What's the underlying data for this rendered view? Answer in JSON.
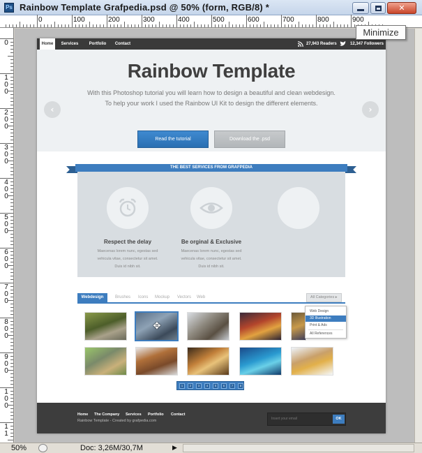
{
  "window": {
    "title": "Rainbow Template Grafpedia.psd @ 50% (form, RGB/8) *",
    "app_icon_label": "Ps",
    "minimize_tooltip": "Minimize",
    "close_glyph": "✕"
  },
  "rulers": {
    "top_labels": [
      "0",
      "100",
      "200",
      "300",
      "400",
      "500",
      "600",
      "700",
      "800",
      "900"
    ],
    "left_labels": [
      "0",
      "1\n0\n0",
      "2\n0\n0",
      "3\n0\n0",
      "4\n0\n0",
      "5\n0\n0",
      "6\n0\n0",
      "7\n0\n0",
      "8\n0\n0",
      "9\n0\n0",
      "1\n0\n0",
      "1\n1"
    ]
  },
  "page": {
    "nav": {
      "items": [
        "Home",
        "Services",
        "Portfolio",
        "Contact"
      ],
      "readers": "27,943 Readers",
      "followers": "12,347 Followers"
    },
    "hero": {
      "title": "Rainbow Template",
      "desc_line1": "With this Photoshop tutorial you will learn how to design a beautiful and clean webdesign.",
      "desc_line2": "To help your work I used the Rainbow UI Kit to design the different elements.",
      "prev_glyph": "‹",
      "next_glyph": "›",
      "primary_button": "Read the tutorial",
      "secondary_button": "Download the .psd"
    },
    "services": {
      "ribbon": "THE BEST SERVICES FROM GRAFPEDIA",
      "items": [
        {
          "title": "Respect the delay",
          "icon": "alarm-clock-icon",
          "desc": [
            "Maecenas lorem nunc, egestas sed",
            "vehicula vitae, consectetur sit amet.",
            "Duis id nibh sit."
          ]
        },
        {
          "title": "Be orginal & Exclusive",
          "icon": "eye-icon",
          "desc": [
            "Maecenas lorem nunc, egestas sed",
            "vehicula vitae, consectetur sit amet.",
            "Duis id nibh sit."
          ]
        },
        {
          "title": "",
          "icon": "",
          "desc": []
        }
      ]
    },
    "portfolio": {
      "tabs": [
        "Webdesign",
        "Brushes",
        "Icons",
        "Mockup",
        "Vectors",
        "Web"
      ],
      "category_dropdown": "All Categories ▸",
      "menu": [
        "Web Design",
        "3D Illustration",
        "Print & Ads",
        "All References"
      ],
      "menu_selected": 1,
      "pages": [
        "1",
        "2",
        "3",
        "4",
        "5",
        "6",
        "7",
        "8"
      ]
    },
    "footer": {
      "links": [
        "Home",
        "The Company",
        "Services",
        "Portfolio",
        "Contact"
      ],
      "copyright": "Rainbow Template - Created by grafpedia.com",
      "email_placeholder": "Insert your email",
      "ok_button": "OK"
    }
  },
  "statusbar": {
    "zoom": "50%",
    "doc_size": "Doc: 3,26M/30,7M",
    "arrow": "▶"
  },
  "colors": {
    "accent_blue": "#3d7dbf",
    "nav_dark": "#3a3a3a",
    "hero_bg": "#eef1f3"
  }
}
